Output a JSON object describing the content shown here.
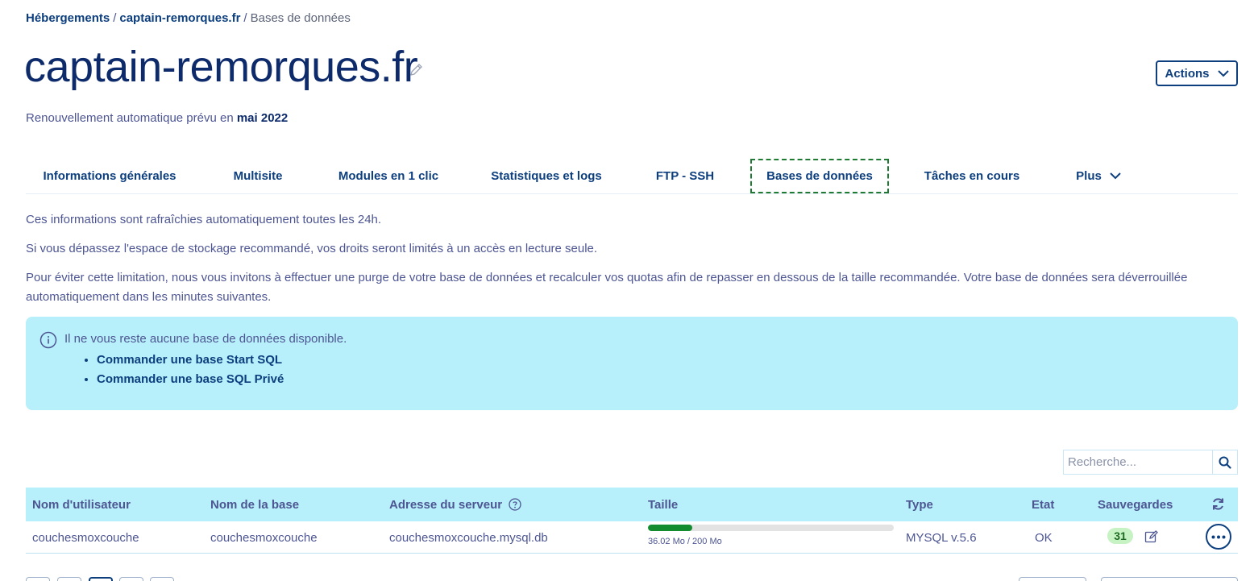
{
  "breadcrumb": {
    "root": "Hébergements",
    "sep": "/",
    "domain": "captain-remorques.fr",
    "current": "Bases de données"
  },
  "header": {
    "title": "captain-remorques.fr",
    "actions_label": "Actions",
    "renewal_prefix": "Renouvellement automatique prévu en",
    "renewal_date": "mai 2022"
  },
  "tabs": [
    {
      "label": "Informations générales"
    },
    {
      "label": "Multisite"
    },
    {
      "label": "Modules en 1 clic"
    },
    {
      "label": "Statistiques et logs"
    },
    {
      "label": "FTP - SSH"
    },
    {
      "label": "Bases de données",
      "active": true
    },
    {
      "label": "Tâches en cours"
    },
    {
      "label": "Plus"
    }
  ],
  "info": {
    "line1": "Ces informations sont rafraîchies automatiquement toutes les 24h.",
    "line2": "Si vous dépassez l'espace de stockage recommandé, vos droits seront limités à un accès en lecture seule.",
    "line3": "Pour éviter cette limitation, nous vous invitons à effectuer une purge de votre base de données et recalculer vos quotas afin de repasser en dessous de la taille recommandée. Votre base de données sera déverrouillée automatiquement dans les minutes suivantes."
  },
  "notice": {
    "message": "Il ne vous reste aucune base de données disponible.",
    "links": [
      "Commander une base Start SQL",
      "Commander une base SQL Privé"
    ]
  },
  "search": {
    "placeholder": "Recherche..."
  },
  "table": {
    "headers": {
      "user": "Nom d'utilisateur",
      "base": "Nom de la base",
      "server": "Adresse du serveur",
      "size": "Taille",
      "type": "Type",
      "state": "Etat",
      "backups": "Sauvegardes"
    },
    "rows": [
      {
        "user": "couchesmoxcouche",
        "base": "couchesmoxcouche",
        "server": "couchesmoxcouche.mysql.db",
        "size_label": "36.02 Mo / 200 Mo",
        "size_used": 36.02,
        "size_total": 200,
        "type": "MYSQL v.5.6",
        "state": "OK",
        "backups": "31"
      }
    ]
  },
  "colors": {
    "link": "#0d3f7f",
    "title": "#0d2a6b",
    "text": "#4d5693",
    "notice_bg": "#b7f0fa",
    "progress_fill": "#128c2e",
    "badge_bg": "#c7f2c4"
  }
}
